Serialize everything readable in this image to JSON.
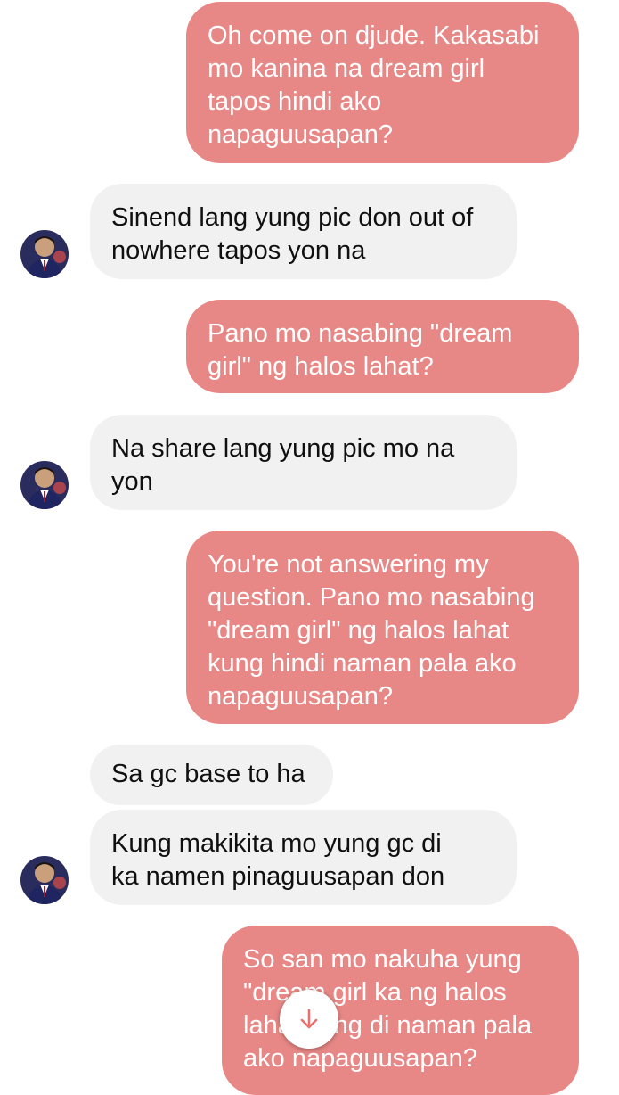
{
  "colors": {
    "outgoing_bubble": "#e88886",
    "incoming_bubble": "#f1f1f1",
    "accent_arrow": "#e8706e"
  },
  "messages": [
    {
      "direction": "outgoing",
      "text": "Oh come on djude. Kakasabi\nmo kanina na dream girl\ntapos hindi ako\nnapaguusapan?"
    },
    {
      "direction": "incoming",
      "text": "Sinend lang yung pic don out of\nnowhere tapos yon na"
    },
    {
      "direction": "outgoing",
      "text": "Pano mo nasabing \"dream\ngirl\" ng halos lahat?"
    },
    {
      "direction": "incoming",
      "text": "Na share lang yung pic mo na\nyon"
    },
    {
      "direction": "outgoing",
      "text": "You're not answering my\nquestion. Pano mo nasabing\n\"dream girl\" ng halos lahat\nkung hindi naman pala ako\nnapaguusapan?"
    },
    {
      "direction": "incoming",
      "text": "Sa gc base to ha"
    },
    {
      "direction": "incoming",
      "text": "Kung makikita mo yung gc di\nka namen pinaguusapan don"
    },
    {
      "direction": "outgoing",
      "text": "So san mo nakuha yung\n\"dream girl ka ng halos\nlahat kung di naman pala\nako napaguusapan?"
    }
  ],
  "icons": {
    "scroll_down": "arrow-down-icon",
    "avatar": "contact-avatar"
  }
}
